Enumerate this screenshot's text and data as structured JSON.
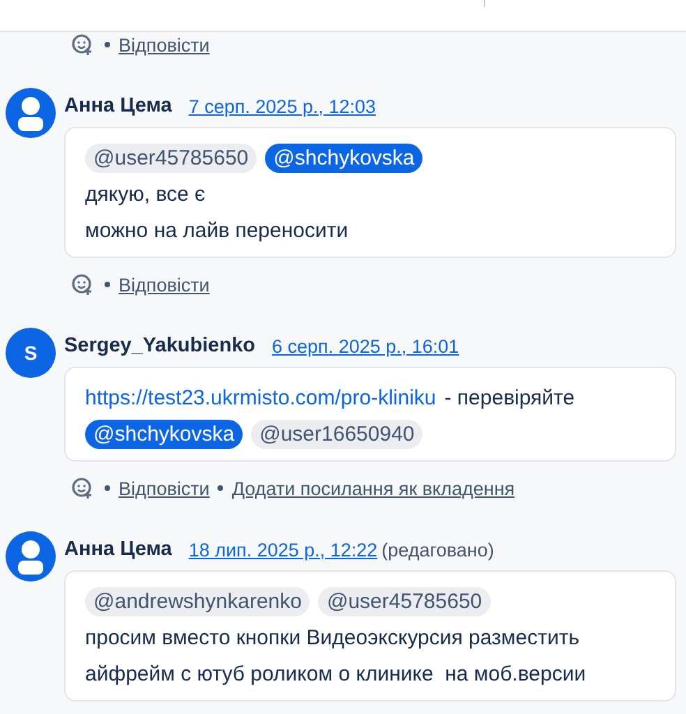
{
  "top_actions": {
    "links": [
      "Відповісти"
    ]
  },
  "comments": [
    {
      "author": "Анна Цема",
      "avatar": {
        "kind": "person"
      },
      "date": "7 серп. 2025 р., 12:03",
      "lines": [
        [
          {
            "kind": "mention",
            "text": "@user45785650",
            "selected": false
          },
          {
            "kind": "mention",
            "text": "@shchykovska",
            "selected": true
          }
        ],
        [
          {
            "kind": "text",
            "text": "дякую, все є"
          }
        ],
        [
          {
            "kind": "text",
            "text": "можно на лайв переносити"
          }
        ]
      ],
      "links": [
        "Відповісти"
      ]
    },
    {
      "author": "Sergey_Yakubienko",
      "avatar": {
        "kind": "initial",
        "letter": "S"
      },
      "date": "6 серп. 2025 р., 16:01",
      "lines": [
        [
          {
            "kind": "link",
            "text": "https://test23.ukrmisto.com/pro-kliniku"
          },
          {
            "kind": "text",
            "text": "- перевіряйте"
          }
        ],
        [
          {
            "kind": "mention",
            "text": "@shchykovska",
            "selected": true
          },
          {
            "kind": "mention",
            "text": "@user16650940",
            "selected": false
          }
        ]
      ],
      "links": [
        "Відповісти",
        "Додати посилання як вкладення"
      ]
    },
    {
      "author": "Анна Цема",
      "avatar": {
        "kind": "person"
      },
      "date": "18 лип. 2025 р., 12:22",
      "edited": "(редаговано)",
      "lines": [
        [
          {
            "kind": "mention",
            "text": "@andrewshynkarenko",
            "selected": false
          },
          {
            "kind": "mention",
            "text": "@user45785650",
            "selected": false
          }
        ],
        [
          {
            "kind": "text",
            "text": "просим вместо кнопки Видеоэкскурсия разместить"
          }
        ],
        [
          {
            "kind": "text",
            "text": "айфрейм с ютуб роликом о клинике  на моб.версии"
          }
        ]
      ]
    }
  ]
}
